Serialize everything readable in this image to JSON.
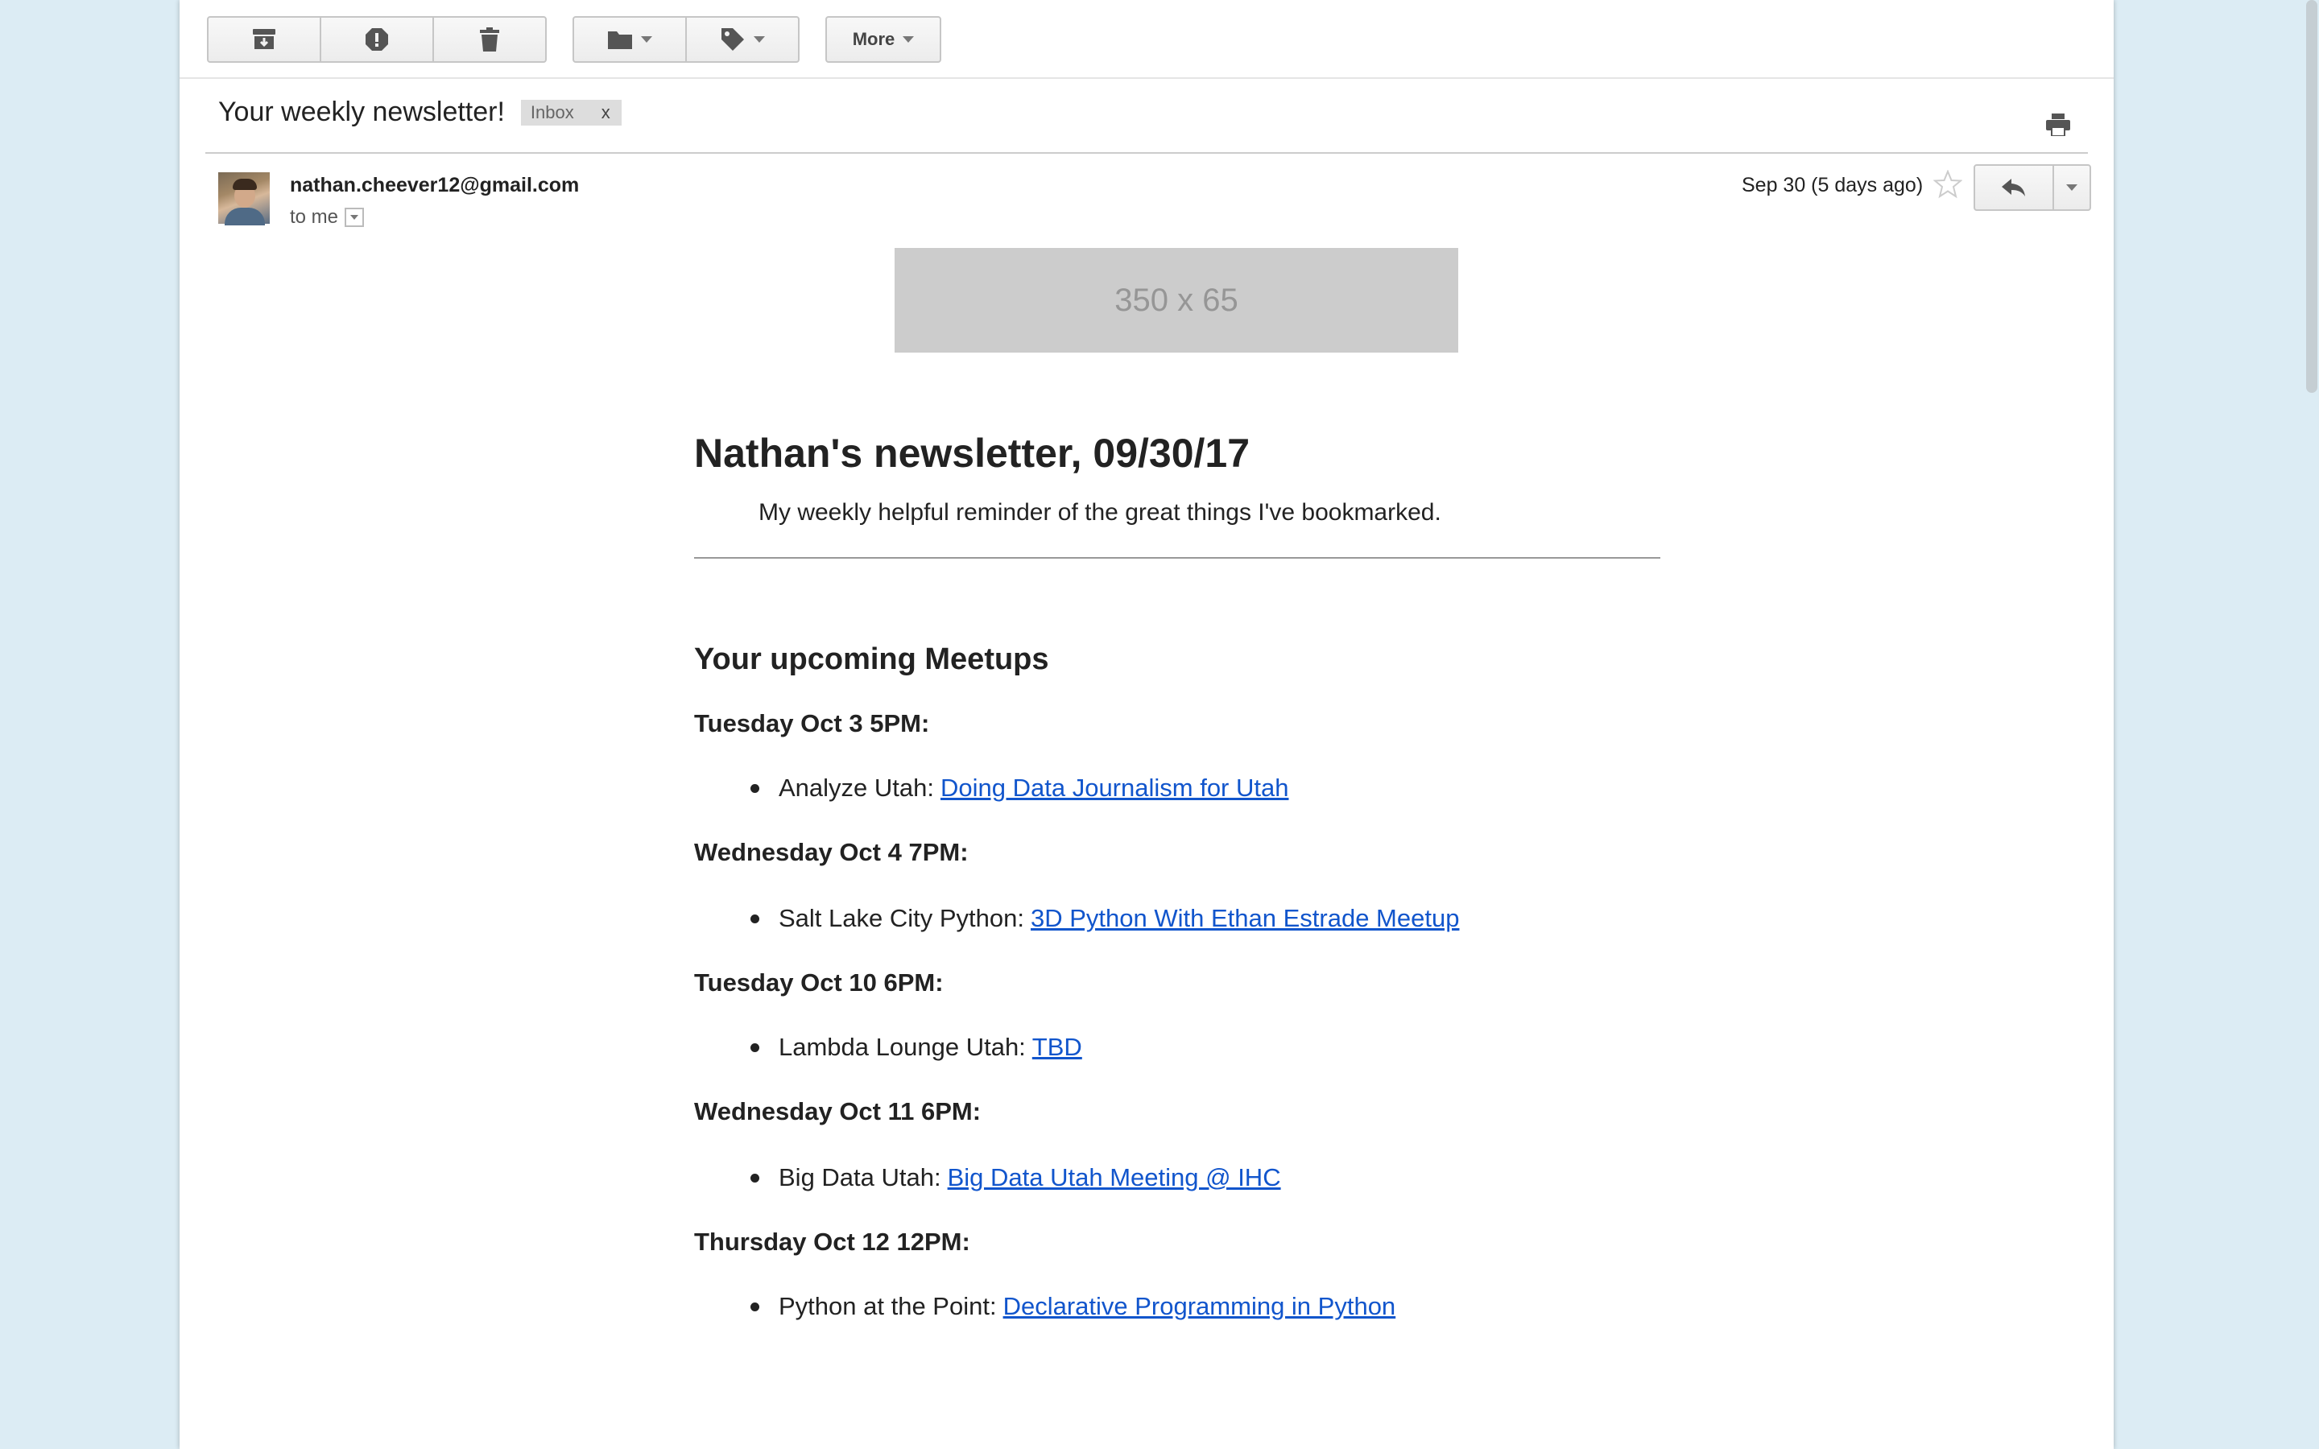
{
  "toolbar": {
    "buttons": [
      "archive-icon",
      "report-spam-icon",
      "delete-icon",
      "move-to-folder-icon",
      "labels-icon"
    ],
    "more_label": "More"
  },
  "email": {
    "subject": "Your weekly newsletter!",
    "label": "Inbox",
    "label_remove": "x",
    "sender": "nathan.cheever12@gmail.com",
    "recipient": "to me",
    "date": "Sep 30 (5 days ago)"
  },
  "body": {
    "header_image_text": "350 x 65",
    "title": "Nathan's newsletter, 09/30/17",
    "subtitle": "My weekly helpful reminder of the great things I've bookmarked.",
    "section_title": "Your upcoming Meetups",
    "events": [
      {
        "date": "Tuesday Oct 3 5PM:",
        "group": "Analyze Utah:",
        "link": "Doing Data Journalism for Utah"
      },
      {
        "date": "Wednesday Oct 4 7PM:",
        "group": "Salt Lake City Python:",
        "link": "3D Python With Ethan Estrade Meetup"
      },
      {
        "date": "Tuesday Oct 10 6PM:",
        "group": "Lambda Lounge Utah:",
        "link": "TBD"
      },
      {
        "date": "Wednesday Oct 11 6PM:",
        "group": "Big Data Utah:",
        "link": "Big Data Utah Meeting @ IHC"
      },
      {
        "date": "Thursday Oct 12 12PM:",
        "group": "Python at the Point:",
        "link": "Declarative Programming in Python"
      }
    ]
  },
  "colors": {
    "background": "#dcecf4",
    "link": "#1155cc",
    "label_chip": "#dddddd"
  }
}
